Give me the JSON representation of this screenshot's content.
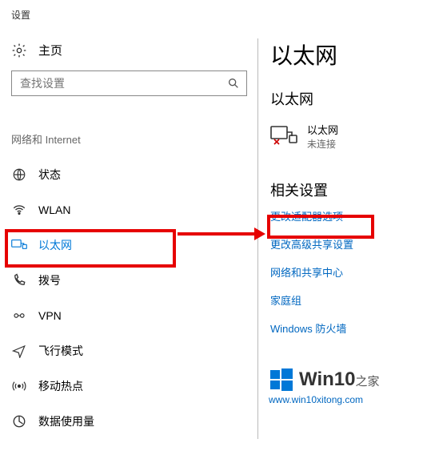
{
  "app_title": "设置",
  "home_label": "主页",
  "search_placeholder": "查找设置",
  "section_label": "网络和 Internet",
  "nav": [
    {
      "id": "status",
      "label": "状态",
      "icon": "status-icon",
      "selected": false
    },
    {
      "id": "wlan",
      "label": "WLAN",
      "icon": "wifi-icon",
      "selected": false
    },
    {
      "id": "ethernet",
      "label": "以太网",
      "icon": "ethernet-icon",
      "selected": true
    },
    {
      "id": "dialup",
      "label": "拨号",
      "icon": "dialup-icon",
      "selected": false
    },
    {
      "id": "vpn",
      "label": "VPN",
      "icon": "vpn-icon",
      "selected": false
    },
    {
      "id": "airplane",
      "label": "飞行模式",
      "icon": "airplane-icon",
      "selected": false
    },
    {
      "id": "hotspot",
      "label": "移动热点",
      "icon": "hotspot-icon",
      "selected": false
    },
    {
      "id": "datausage",
      "label": "数据使用量",
      "icon": "datausage-icon",
      "selected": false
    }
  ],
  "page_title": "以太网",
  "subsection_title": "以太网",
  "device": {
    "name": "以太网",
    "status": "未连接"
  },
  "related_title": "相关设置",
  "related_links": [
    "更改适配器选项",
    "更改高级共享设置",
    "网络和共享中心",
    "家庭组",
    "Windows 防火墙"
  ],
  "watermark": {
    "title_main": "Win10",
    "title_suffix": "之家",
    "url": "www.win10xitong.com"
  },
  "accent": "#0078d7"
}
